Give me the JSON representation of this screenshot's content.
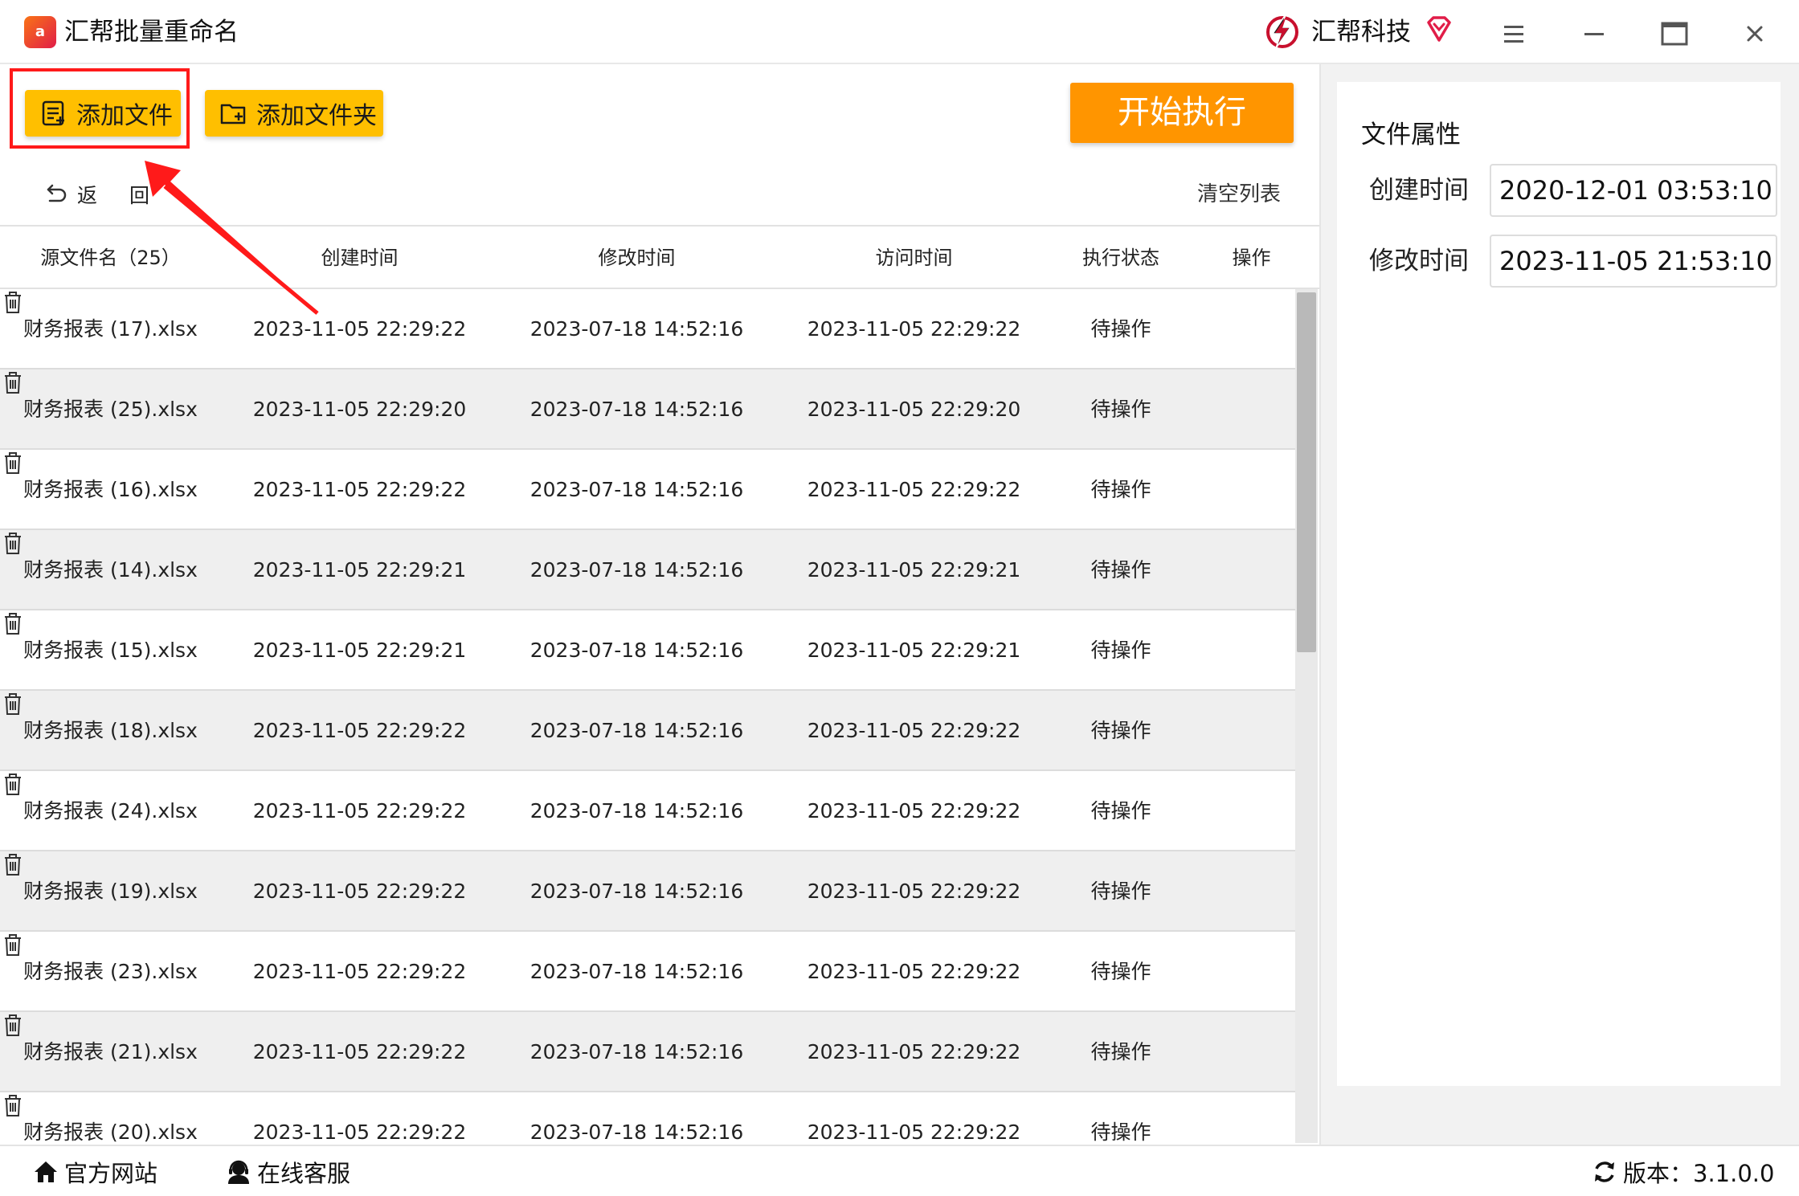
{
  "app": {
    "title": "汇帮批量重命名",
    "icon_text": "a",
    "brand_name": "汇帮科技"
  },
  "toolbar": {
    "add_file_label": "添加文件",
    "add_folder_label": "添加文件夹",
    "start_label": "开始执行",
    "back_label": "返回",
    "clear_list_label": "清空列表"
  },
  "table": {
    "headers": {
      "name": "源文件名（25）",
      "ctime": "创建时间",
      "mtime": "修改时间",
      "atime": "访问时间",
      "status": "执行状态",
      "op": "操作"
    },
    "rows": [
      {
        "name": "财务报表 (17).xlsx",
        "ctime": "2023-11-05 22:29:22",
        "mtime": "2023-07-18 14:52:16",
        "atime": "2023-11-05 22:29:22",
        "status": "待操作"
      },
      {
        "name": "财务报表 (25).xlsx",
        "ctime": "2023-11-05 22:29:20",
        "mtime": "2023-07-18 14:52:16",
        "atime": "2023-11-05 22:29:20",
        "status": "待操作"
      },
      {
        "name": "财务报表 (16).xlsx",
        "ctime": "2023-11-05 22:29:22",
        "mtime": "2023-07-18 14:52:16",
        "atime": "2023-11-05 22:29:22",
        "status": "待操作"
      },
      {
        "name": "财务报表 (14).xlsx",
        "ctime": "2023-11-05 22:29:21",
        "mtime": "2023-07-18 14:52:16",
        "atime": "2023-11-05 22:29:21",
        "status": "待操作"
      },
      {
        "name": "财务报表 (15).xlsx",
        "ctime": "2023-11-05 22:29:21",
        "mtime": "2023-07-18 14:52:16",
        "atime": "2023-11-05 22:29:21",
        "status": "待操作"
      },
      {
        "name": "财务报表 (18).xlsx",
        "ctime": "2023-11-05 22:29:22",
        "mtime": "2023-07-18 14:52:16",
        "atime": "2023-11-05 22:29:22",
        "status": "待操作"
      },
      {
        "name": "财务报表 (24).xlsx",
        "ctime": "2023-11-05 22:29:22",
        "mtime": "2023-07-18 14:52:16",
        "atime": "2023-11-05 22:29:22",
        "status": "待操作"
      },
      {
        "name": "财务报表 (19).xlsx",
        "ctime": "2023-11-05 22:29:22",
        "mtime": "2023-07-18 14:52:16",
        "atime": "2023-11-05 22:29:22",
        "status": "待操作"
      },
      {
        "name": "财务报表 (23).xlsx",
        "ctime": "2023-11-05 22:29:22",
        "mtime": "2023-07-18 14:52:16",
        "atime": "2023-11-05 22:29:22",
        "status": "待操作"
      },
      {
        "name": "财务报表 (21).xlsx",
        "ctime": "2023-11-05 22:29:22",
        "mtime": "2023-07-18 14:52:16",
        "atime": "2023-11-05 22:29:22",
        "status": "待操作"
      },
      {
        "name": "财务报表 (20).xlsx",
        "ctime": "2023-11-05 22:29:22",
        "mtime": "2023-07-18 14:52:16",
        "atime": "2023-11-05 22:29:22",
        "status": "待操作"
      }
    ]
  },
  "properties": {
    "title": "文件属性",
    "ctime_label": "创建时间",
    "ctime_value": "2020-12-01 03:53:10",
    "mtime_label": "修改时间",
    "mtime_value": "2023-11-05 21:53:10"
  },
  "footer": {
    "site_label": "官方网站",
    "service_label": "在线客服",
    "version_label": "版本：3.1.0.0"
  },
  "colors": {
    "accent_yellow": "#ffbf00",
    "start_orange": "#ff9500",
    "highlight_red": "#ff1a1a",
    "alt_row": "#efefef"
  },
  "icons": {
    "app": "app-logo-icon",
    "brand": "brand-logo-icon",
    "vip": "diamond-heart-icon",
    "menu": "hamburger-icon",
    "minimize": "minimize-icon",
    "maximize": "maximize-icon",
    "close": "close-icon",
    "add_file": "file-list-icon",
    "add_folder": "folder-plus-icon",
    "back": "undo-arrow-icon",
    "delete": "trash-icon",
    "home": "home-icon",
    "service": "headset-person-icon",
    "refresh": "refresh-icon"
  }
}
